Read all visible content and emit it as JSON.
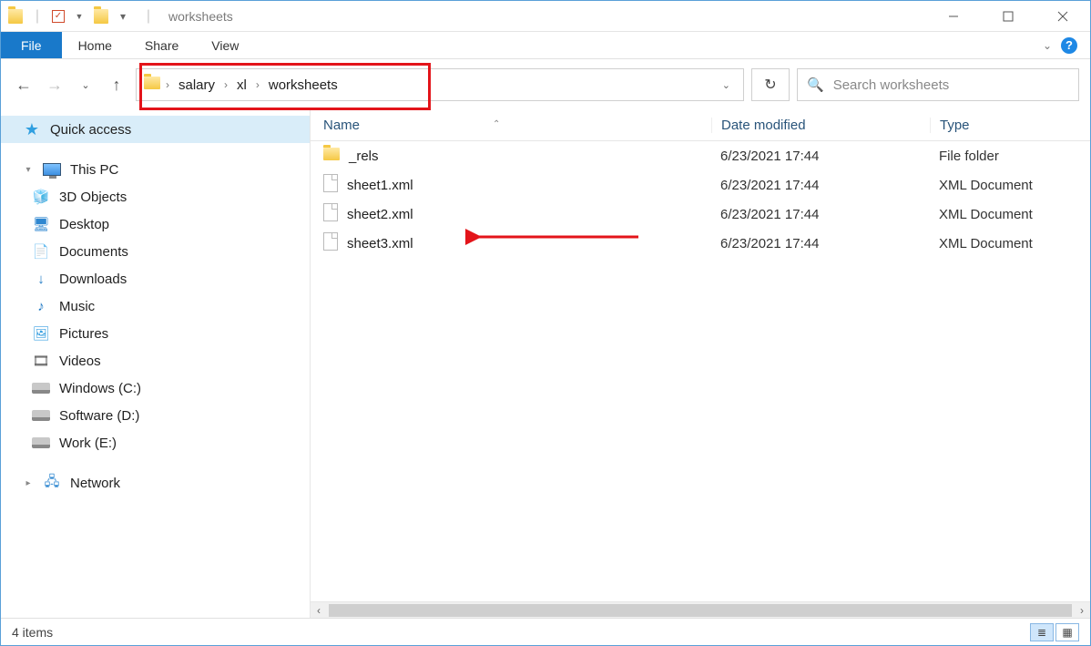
{
  "window": {
    "title": "worksheets"
  },
  "ribbon": {
    "file": "File",
    "tabs": [
      "Home",
      "Share",
      "View"
    ]
  },
  "breadcrumb": [
    "salary",
    "xl",
    "worksheets"
  ],
  "search": {
    "placeholder": "Search worksheets"
  },
  "columns": {
    "name": "Name",
    "date": "Date modified",
    "type": "Type"
  },
  "sidebar": {
    "quick": "Quick access",
    "thispc": "This PC",
    "items": [
      "3D Objects",
      "Desktop",
      "Documents",
      "Downloads",
      "Music",
      "Pictures",
      "Videos",
      "Windows (C:)",
      "Software (D:)",
      "Work (E:)"
    ],
    "network": "Network"
  },
  "files": [
    {
      "name": "_rels",
      "date": "6/23/2021 17:44",
      "type": "File folder",
      "kind": "folder"
    },
    {
      "name": "sheet1.xml",
      "date": "6/23/2021 17:44",
      "type": "XML Document",
      "kind": "file"
    },
    {
      "name": "sheet2.xml",
      "date": "6/23/2021 17:44",
      "type": "XML Document",
      "kind": "file"
    },
    {
      "name": "sheet3.xml",
      "date": "6/23/2021 17:44",
      "type": "XML Document",
      "kind": "file"
    }
  ],
  "status": {
    "count": "4 items"
  }
}
